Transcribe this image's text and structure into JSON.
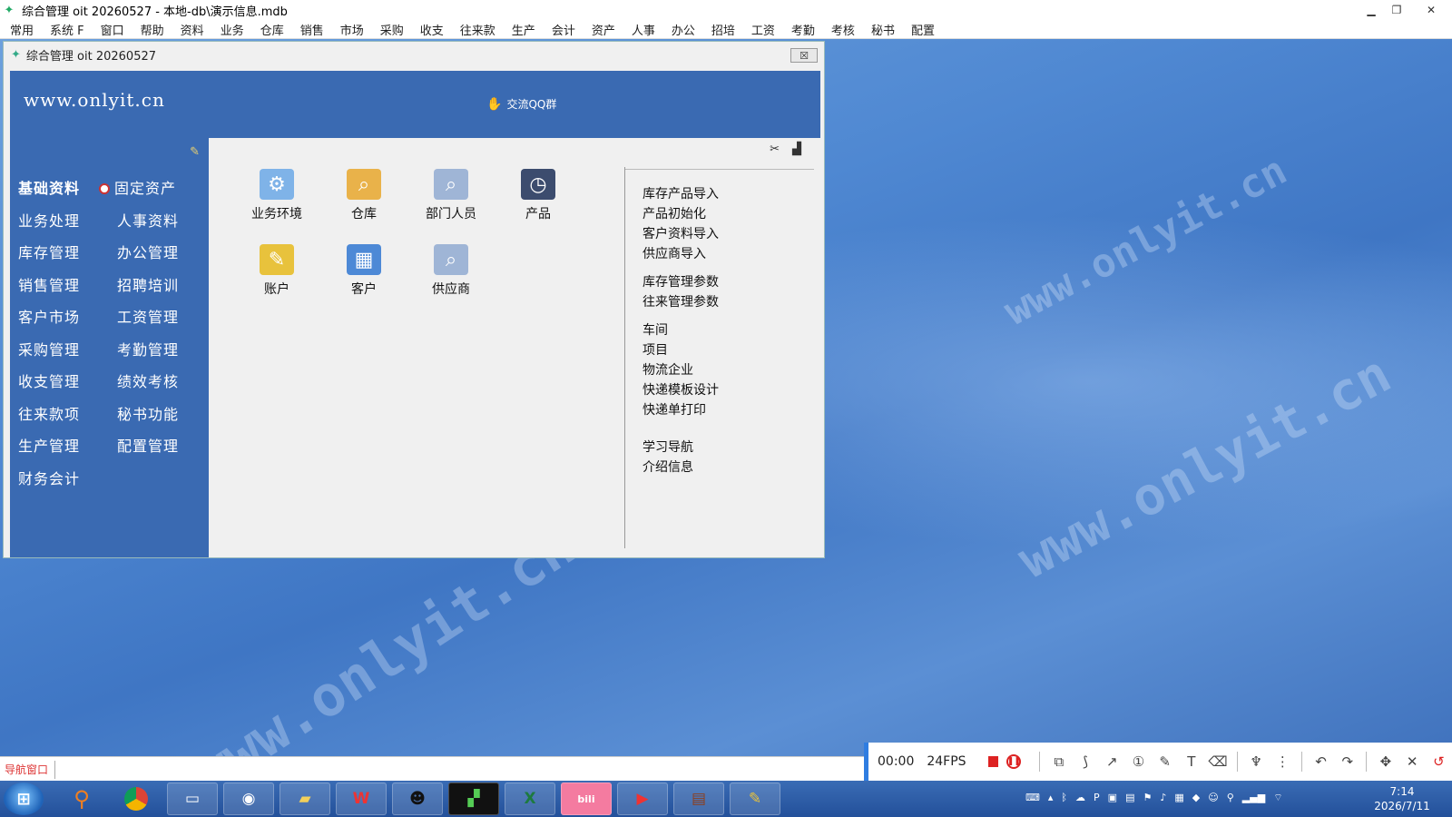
{
  "app": {
    "title": "综合管理 oit 20260527 - 本地-db\\演示信息.mdb"
  },
  "menu": [
    "常用",
    "系统 F",
    "窗口",
    "帮助",
    "资料",
    "业务",
    "仓库",
    "销售",
    "市场",
    "采购",
    "收支",
    "往来款",
    "生产",
    "会计",
    "资产",
    "人事",
    "办公",
    "招培",
    "工资",
    "考勤",
    "考核",
    "秘书",
    "配置"
  ],
  "window": {
    "title": "综合管理 oit 20260527",
    "close": "☒"
  },
  "banner": {
    "site": "www.onlyit.cn",
    "qq_group": "交流QQ群"
  },
  "nav": {
    "left": [
      "基础资料",
      "业务处理",
      "库存管理",
      "销售管理",
      "客户市场",
      "采购管理",
      "收支管理",
      "往来款项",
      "生产管理",
      "财务会计"
    ],
    "right": [
      "固定资产",
      "人事资料",
      "办公管理",
      "招聘培训",
      "工资管理",
      "考勤管理",
      "绩效考核",
      "秘书功能",
      "配置管理"
    ]
  },
  "icons": [
    {
      "label": "业务环境",
      "icon": "settings-icon",
      "color": "#7fb3e8"
    },
    {
      "label": "仓库",
      "icon": "warehouse-search-icon",
      "color": "#e9b24a"
    },
    {
      "label": "部门人员",
      "icon": "people-search-icon",
      "color": "#9fb5d6"
    },
    {
      "label": "产品",
      "icon": "clock-icon",
      "color": "#3c4c6e"
    },
    {
      "label": "账户",
      "icon": "account-icon",
      "color": "#e8c23c"
    },
    {
      "label": "客户",
      "icon": "calculator-icon",
      "color": "#4d89d6"
    },
    {
      "label": "供应商",
      "icon": "supplier-search-icon",
      "color": "#9fb5d6"
    }
  ],
  "links": [
    {
      "group": 1,
      "label": "库存产品导入"
    },
    {
      "group": 1,
      "label": "产品初始化"
    },
    {
      "group": 1,
      "label": "客户资料导入"
    },
    {
      "group": 1,
      "label": "供应商导入"
    },
    {
      "group": 2,
      "label": "库存管理参数"
    },
    {
      "group": 2,
      "label": "往来管理参数"
    },
    {
      "group": 3,
      "label": "车间"
    },
    {
      "group": 3,
      "label": "项目"
    },
    {
      "group": 3,
      "label": "物流企业"
    },
    {
      "group": 3,
      "label": "快递模板设计"
    },
    {
      "group": 3,
      "label": "快递单打印"
    },
    {
      "group": 4,
      "label": "学习导航"
    },
    {
      "group": 4,
      "label": "介绍信息"
    }
  ],
  "statusbar": {
    "nav_window": "导航窗口"
  },
  "recorder": {
    "time": "00:00",
    "fps": "24FPS"
  },
  "taskbar": {
    "time": "7:14",
    "date": "2026/7/11"
  },
  "watermark": "www.onlyit.cn"
}
